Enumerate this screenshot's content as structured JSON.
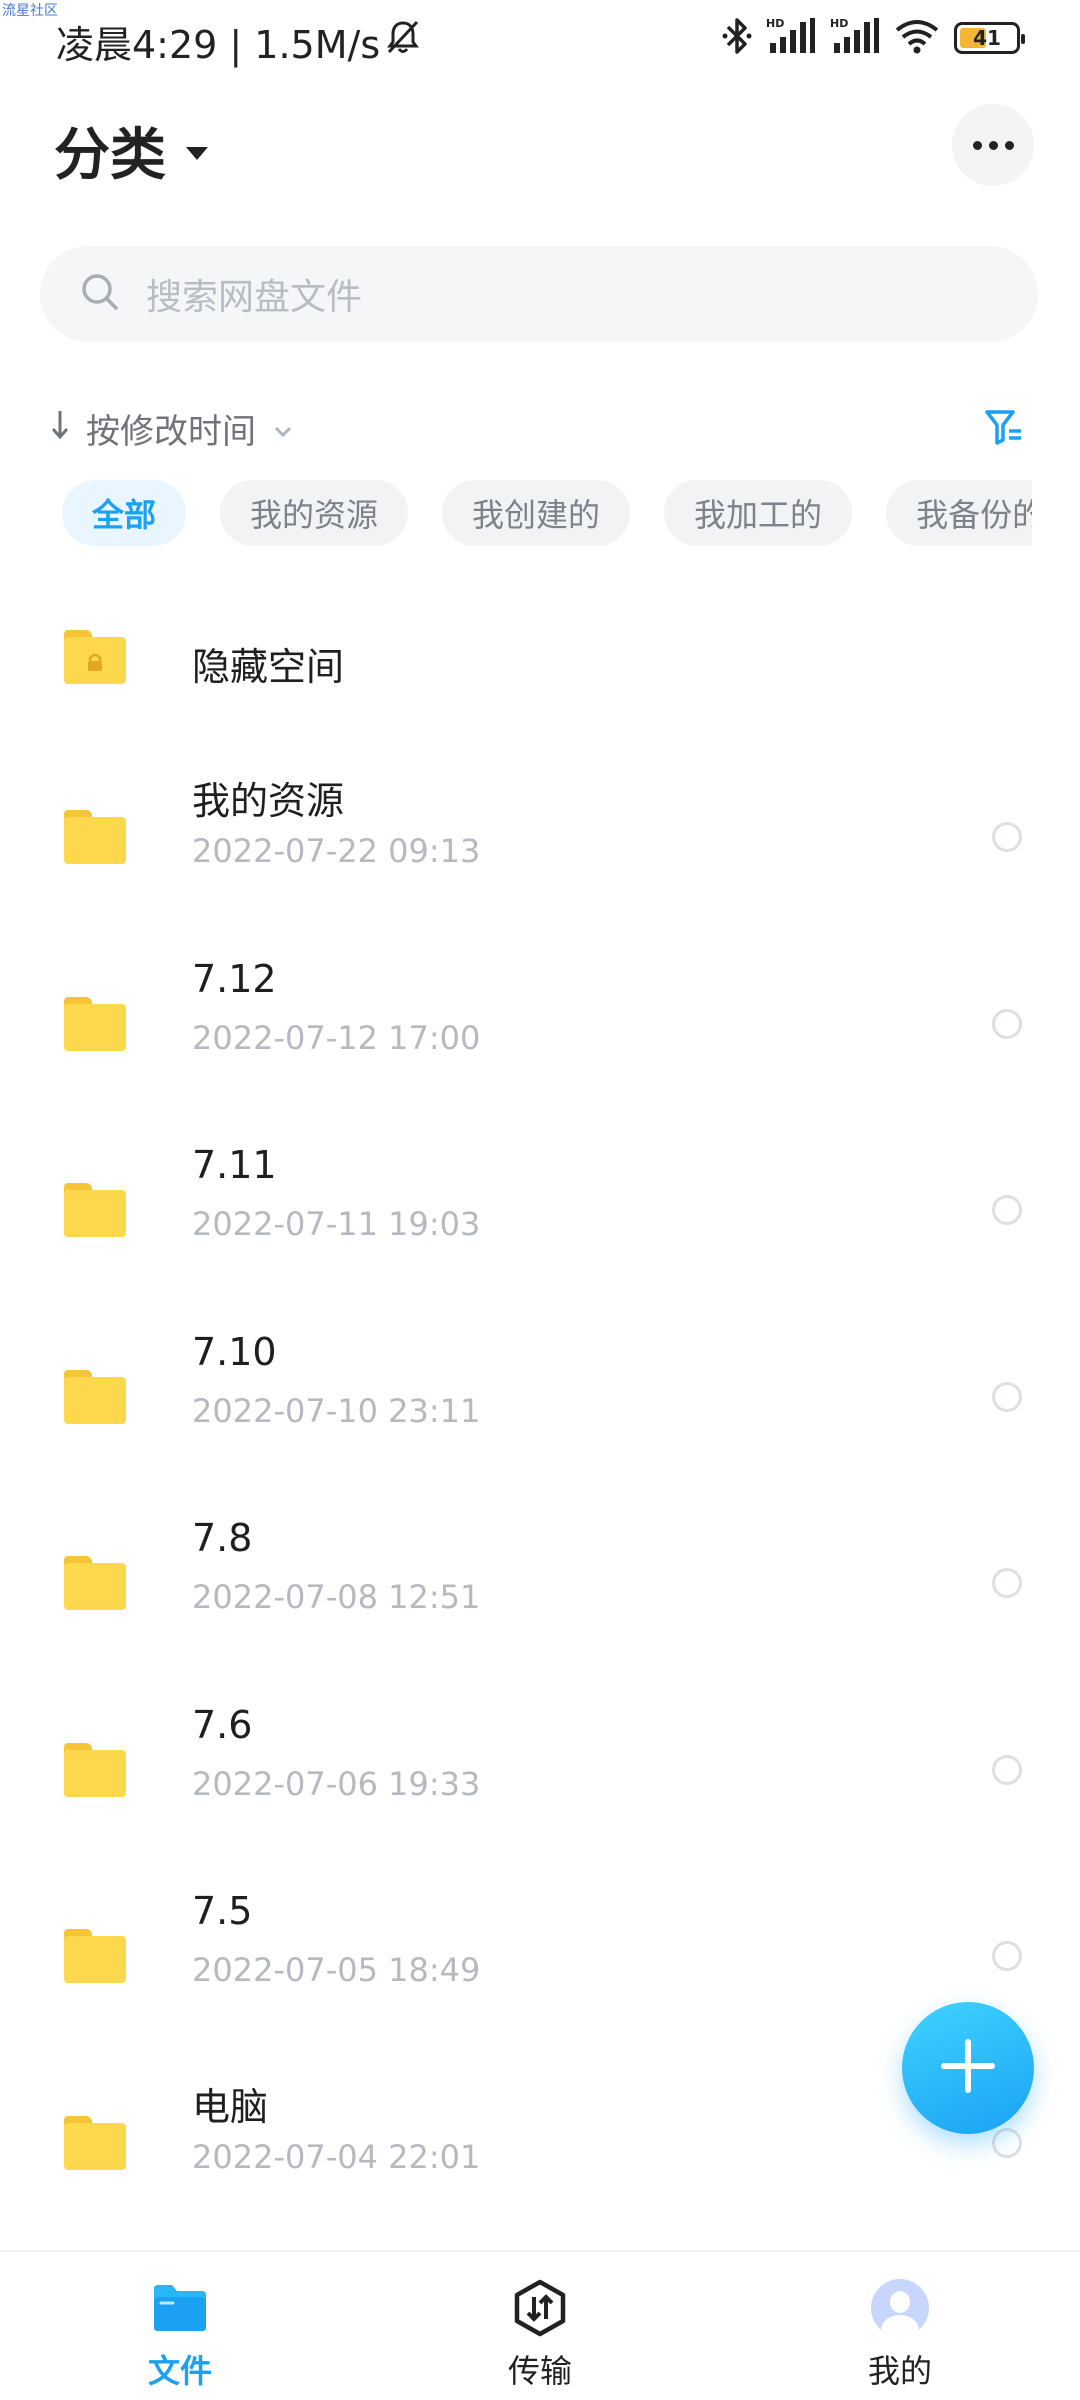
{
  "watermark": "流星社区",
  "status_bar": {
    "time_text": "凌晨4:29 | 1.5M/s",
    "battery": "41",
    "icons": [
      "mute-bell-icon",
      "bluetooth-icon",
      "hd-signal-icon",
      "hd-signal-icon",
      "wifi-icon",
      "battery-icon"
    ]
  },
  "header": {
    "title": "分类"
  },
  "search": {
    "placeholder": "搜索网盘文件"
  },
  "sort": {
    "label": "按修改时间"
  },
  "chips": [
    "全部",
    "我的资源",
    "我创建的",
    "我加工的",
    "我备份的"
  ],
  "files": [
    {
      "name": "隐藏空间",
      "date": "",
      "locked": true
    },
    {
      "name": "我的资源",
      "date": "2022-07-22  09:13"
    },
    {
      "name": "7.12",
      "date": "2022-07-12  17:00"
    },
    {
      "name": "7.11",
      "date": "2022-07-11  19:03"
    },
    {
      "name": "7.10",
      "date": "2022-07-10  23:11"
    },
    {
      "name": "7.8",
      "date": "2022-07-08  12:51"
    },
    {
      "name": "7.6",
      "date": "2022-07-06  19:33"
    },
    {
      "name": "7.5",
      "date": "2022-07-05  18:49"
    },
    {
      "name": "电脑",
      "date": "2022-07-04  22:01"
    }
  ],
  "bottom_nav": {
    "files": "文件",
    "transfer": "传输",
    "mine": "我的"
  },
  "colors": {
    "accent": "#1aa1f2",
    "folder": "#fdd84d",
    "date_text": "#b6b9bf"
  }
}
